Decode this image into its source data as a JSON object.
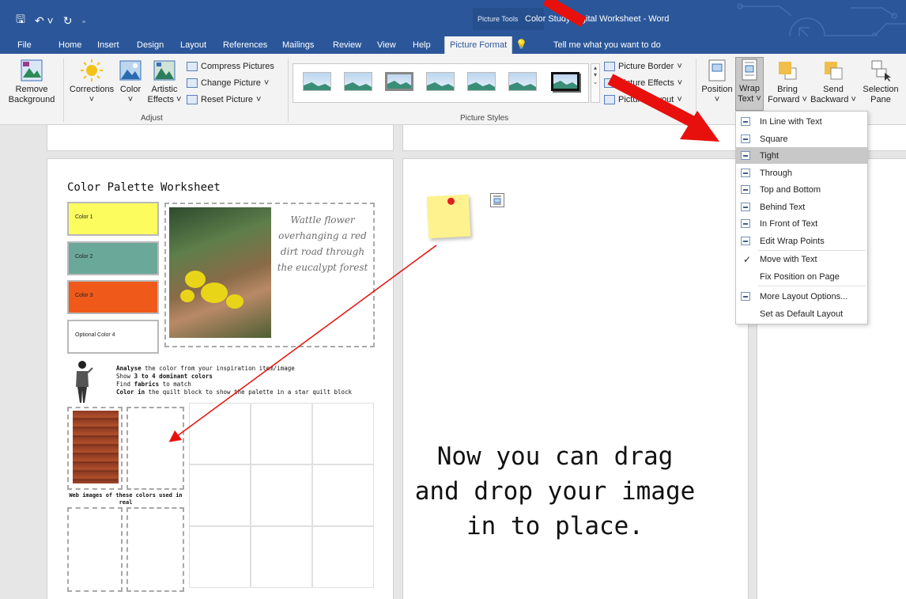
{
  "window": {
    "context_label": "Picture Tools",
    "title": "Color Study Digital Worksheet  -  Word"
  },
  "tabs": [
    {
      "label": "File"
    },
    {
      "label": "Home"
    },
    {
      "label": "Insert"
    },
    {
      "label": "Design"
    },
    {
      "label": "Layout"
    },
    {
      "label": "References"
    },
    {
      "label": "Mailings"
    },
    {
      "label": "Review"
    },
    {
      "label": "View"
    },
    {
      "label": "Help"
    },
    {
      "label": "Picture Format"
    }
  ],
  "tell_me": "Tell me what you want to do",
  "ribbon": {
    "remove_bg": {
      "line1": "Remove",
      "line2": "Background"
    },
    "corrections": "Corrections",
    "color": "Color",
    "artistic": {
      "line1": "Artistic",
      "line2": "Effects"
    },
    "compress": "Compress Pictures",
    "change": "Change Picture",
    "reset": "Reset Picture",
    "adjust_label": "Adjust",
    "picture_border": "Picture Border",
    "picture_effects": "Picture Effects",
    "picture_layout": "Picture Layout",
    "picture_styles_label": "Picture Styles",
    "position": "Position",
    "wrap": {
      "line1": "Wrap",
      "line2": "Text"
    },
    "bring": {
      "line1": "Bring",
      "line2": "Forward"
    },
    "send": {
      "line1": "Send",
      "line2": "Backward"
    },
    "selection": {
      "line1": "Selection",
      "line2": "Pane"
    }
  },
  "wrap_menu": [
    {
      "label": "In Line with Text",
      "icon": "inline-icon"
    },
    {
      "label": "Square",
      "icon": "square-wrap-icon"
    },
    {
      "label": "Tight",
      "icon": "tight-wrap-icon",
      "highlighted": true
    },
    {
      "label": "Through",
      "icon": "through-wrap-icon"
    },
    {
      "label": "Top and Bottom",
      "icon": "top-bottom-icon"
    },
    {
      "label": "Behind Text",
      "icon": "behind-text-icon"
    },
    {
      "label": "In Front of Text",
      "icon": "front-text-icon"
    },
    {
      "label": "Edit Wrap Points",
      "icon": "edit-points-icon"
    },
    {
      "label": "Move with Text",
      "checked": true
    },
    {
      "label": "Fix Position on Page"
    },
    {
      "label": "More Layout Options...",
      "icon": "layout-options-icon"
    },
    {
      "label": "Set as Default Layout"
    }
  ],
  "worksheet": {
    "title": "Color Palette Worksheet",
    "swatches": [
      {
        "label": "Color 1",
        "color": "#fcfc5e"
      },
      {
        "label": "Color 2",
        "color": "#6aa89a"
      },
      {
        "label": "Color 3",
        "color": "#ef5a1a"
      },
      {
        "label": "Optional Color 4",
        "color": "#ffffff"
      }
    ],
    "caption": "Wattle flower overhanging a red dirt road through the eucalypt forest",
    "instructions": [
      {
        "bold": "Analyse",
        "rest": " the color from your inspiration item/image"
      },
      {
        "pre": "Show ",
        "bold": "3 to 4 dominant colors",
        "rest": ""
      },
      {
        "pre": "Find ",
        "bold": "fabrics",
        "rest": " to match"
      },
      {
        "bold": "Color in",
        "rest": " the quilt block to show the palette in a star quilt block"
      }
    ],
    "web_label": "Web images of these colors used in real"
  },
  "overlay_text": "Now you can drag and drop your image in to place.",
  "colors": {
    "word_blue": "#2b579a",
    "arrow_red": "#e8100c",
    "highlight": "#c8c8c8"
  }
}
